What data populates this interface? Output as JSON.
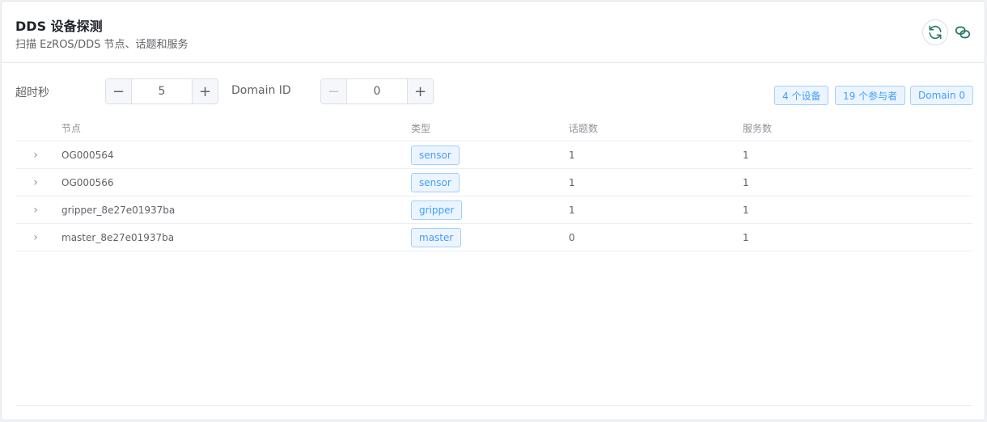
{
  "header": {
    "title": "DDS 设备探测",
    "subtitle": "扫描 EzROS/DDS 节点、话题和服务",
    "refresh_icon": "refresh-icon",
    "link_icon": "link-icon"
  },
  "controls": {
    "timeout_label": "超时秒",
    "timeout_value": "5",
    "domain_label": "Domain ID",
    "domain_value": "0",
    "minus": "−",
    "plus": "+"
  },
  "summary": {
    "devices": "4 个设备",
    "participants": "19 个参与者",
    "domain": "Domain 0"
  },
  "table": {
    "headers": {
      "node": "节点",
      "type": "类型",
      "topics": "话题数",
      "services": "服务数"
    },
    "expand_glyph": "›",
    "rows": [
      {
        "node": "OG000564",
        "type": "sensor",
        "topics": "1",
        "services": "1"
      },
      {
        "node": "OG000566",
        "type": "sensor",
        "topics": "1",
        "services": "1"
      },
      {
        "node": "gripper_8e27e01937ba",
        "type": "gripper",
        "topics": "1",
        "services": "1"
      },
      {
        "node": "master_8e27e01937ba",
        "type": "master",
        "topics": "0",
        "services": "1"
      }
    ]
  },
  "colors": {
    "accent": "#409eff",
    "icon": "#2a7a6a"
  }
}
